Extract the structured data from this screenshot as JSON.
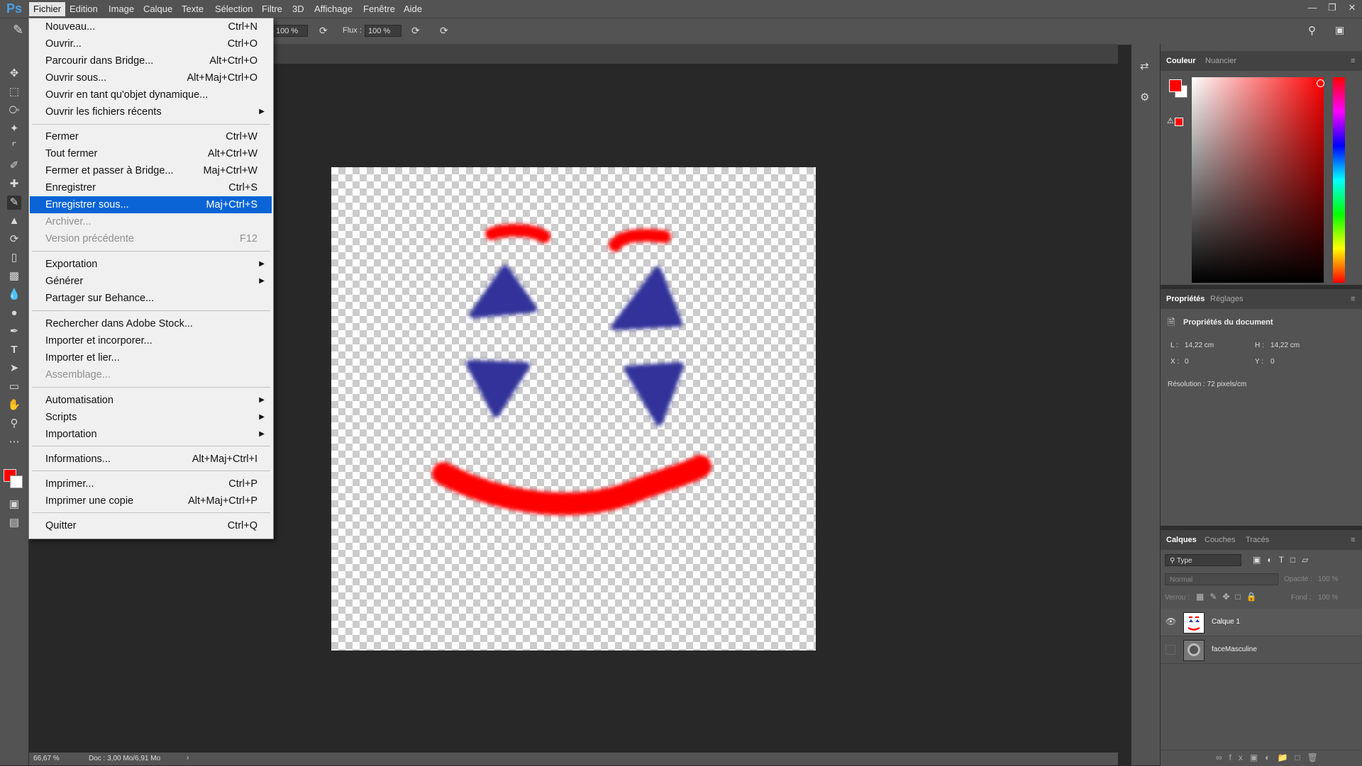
{
  "app": {
    "logo": "Ps"
  },
  "menubar": [
    "Fichier",
    "Edition",
    "Image",
    "Calque",
    "Texte",
    "Sélection",
    "Filtre",
    "3D",
    "Affichage",
    "Fenêtre",
    "Aide"
  ],
  "options": {
    "opacity_value": "100 %",
    "flux_label": "Flux :",
    "flux_value": "100 %"
  },
  "file_menu": {
    "items": [
      {
        "label": "Nouveau...",
        "shortcut": "Ctrl+N"
      },
      {
        "label": "Ouvrir...",
        "shortcut": "Ctrl+O"
      },
      {
        "label": "Parcourir dans Bridge...",
        "shortcut": "Alt+Ctrl+O"
      },
      {
        "label": "Ouvrir sous...",
        "shortcut": "Alt+Maj+Ctrl+O"
      },
      {
        "label": "Ouvrir en tant qu'objet dynamique...",
        "shortcut": ""
      },
      {
        "label": "Ouvrir les fichiers récents",
        "shortcut": ""
      },
      {
        "label": "Fermer",
        "shortcut": "Ctrl+W"
      },
      {
        "label": "Tout fermer",
        "shortcut": "Alt+Ctrl+W"
      },
      {
        "label": "Fermer et passer à Bridge...",
        "shortcut": "Maj+Ctrl+W"
      },
      {
        "label": "Enregistrer",
        "shortcut": "Ctrl+S"
      },
      {
        "label": "Enregistrer sous...",
        "shortcut": "Maj+Ctrl+S"
      },
      {
        "label": "Archiver...",
        "shortcut": ""
      },
      {
        "label": "Version précédente",
        "shortcut": "F12"
      },
      {
        "label": "Exportation",
        "shortcut": ""
      },
      {
        "label": "Générer",
        "shortcut": ""
      },
      {
        "label": "Partager sur Behance...",
        "shortcut": ""
      },
      {
        "label": "Rechercher dans Adobe Stock...",
        "shortcut": ""
      },
      {
        "label": "Importer et incorporer...",
        "shortcut": ""
      },
      {
        "label": "Importer et lier...",
        "shortcut": ""
      },
      {
        "label": "Assemblage...",
        "shortcut": ""
      },
      {
        "label": "Automatisation",
        "shortcut": ""
      },
      {
        "label": "Scripts",
        "shortcut": ""
      },
      {
        "label": "Importation",
        "shortcut": ""
      },
      {
        "label": "Informations...",
        "shortcut": "Alt+Maj+Ctrl+I"
      },
      {
        "label": "Imprimer...",
        "shortcut": "Ctrl+P"
      },
      {
        "label": "Imprimer une copie",
        "shortcut": "Alt+Maj+Ctrl+P"
      },
      {
        "label": "Quitter",
        "shortcut": "Ctrl+Q"
      }
    ]
  },
  "color_panel": {
    "tabs": [
      "Couleur",
      "Nuancier"
    ],
    "foreground": "#ff0000",
    "background": "#ffffff"
  },
  "properties_panel": {
    "tabs": [
      "Propriétés",
      "Réglages"
    ],
    "title": "Propriétés du document",
    "w_label": "L :",
    "w_value": "14,22 cm",
    "h_label": "H :",
    "h_value": "14,22 cm",
    "x_label": "X :",
    "x_value": "0",
    "y_label": "Y :",
    "y_value": "0",
    "resolution": "Résolution : 72 pixels/cm"
  },
  "layers_panel": {
    "tabs": [
      "Calques",
      "Couches",
      "Tracés"
    ],
    "filter": "Type",
    "blend_mode": "Normal",
    "opacity_label": "Opacité :",
    "opacity_value": "100 %",
    "lock_label": "Verrou :",
    "fill_label": "Fond :",
    "fill_value": "100 %",
    "layers": [
      {
        "name": "Calque 1",
        "visible": true
      },
      {
        "name": "faceMasculine",
        "visible": false
      }
    ]
  },
  "status": {
    "zoom": "66,67 %",
    "doc": "Doc : 3,00 Mo/6,91 Mo"
  }
}
